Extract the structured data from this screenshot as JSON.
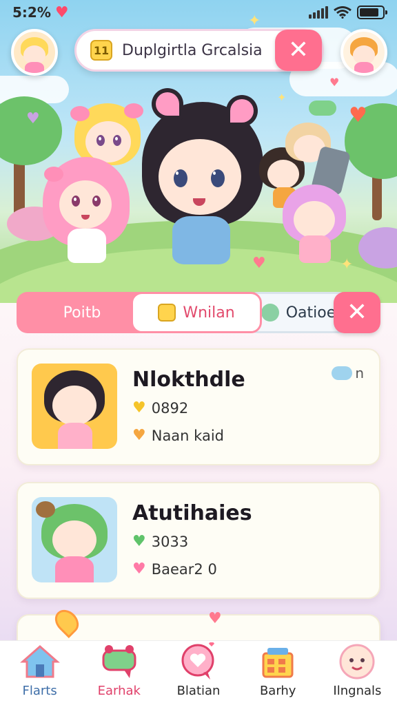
{
  "status_bar": {
    "battery_text": "5:2%",
    "battery_level_fraction": 0.85
  },
  "search": {
    "badge": "11",
    "text": "Duplgirtla Grcalsia",
    "close_glyph": "✕"
  },
  "tabs": {
    "items": [
      {
        "label": "Poitb"
      },
      {
        "label": "Wnilan"
      },
      {
        "label": "Oatioe"
      }
    ],
    "close_glyph": "✕"
  },
  "cards": [
    {
      "title": "Nlokthdle",
      "stat1": "0892",
      "stat2": "Naan kaid",
      "corner_text": "n",
      "thumb_bg": "#ffc94d"
    },
    {
      "title": "Atutihaies",
      "stat1": "3033",
      "stat2": "Baear2 0",
      "corner_text": "",
      "thumb_bg": "#bfe3f6"
    }
  ],
  "bottom_nav": [
    {
      "label": "Flarts",
      "color": "#3e6ea8"
    },
    {
      "label": "Earhak",
      "color": "#e0406a"
    },
    {
      "label": "Blatian",
      "color": "#2a2a2a"
    },
    {
      "label": "Barhy",
      "color": "#2a2a2a"
    },
    {
      "label": "Ilngnals",
      "color": "#2a2a2a"
    }
  ],
  "colors": {
    "accent_pink": "#ff6f8f",
    "panel_bg": "#fbeff5",
    "sky": "#8fd3f0"
  },
  "icons": [
    "heart-icon",
    "signal-icon",
    "wifi-icon",
    "battery-icon",
    "close-icon",
    "home-icon",
    "chat-icon",
    "heart-bubble-icon",
    "building-icon",
    "face-icon"
  ]
}
